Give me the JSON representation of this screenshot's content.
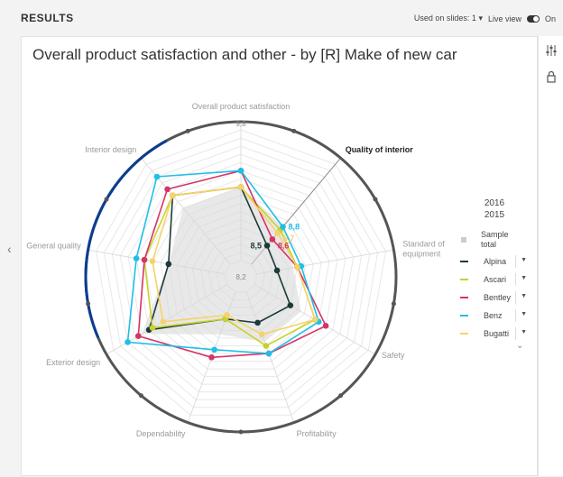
{
  "header": {
    "title": "RESULTS",
    "used_on": "Used on slides: 1",
    "live_view": "Live view",
    "toggle_state": "On"
  },
  "chart_title": "Overall product satisfaction and other - by [R] Make of new car",
  "chart_data": {
    "type": "radar",
    "title": "Overall product satisfaction and other - by [R] Make of new car",
    "axes": [
      "Overall product satisfaction",
      "Quality of interior",
      "Standard of equipment",
      "Safety",
      "Profitability",
      "Dependability",
      "Exterior design",
      "General quality",
      "Interior design"
    ],
    "range": [
      8.2,
      9.8
    ],
    "center_label": "8,2",
    "outer_label": "9,8",
    "highlighted_axis": "Quality of interior",
    "series": [
      {
        "name": "Sample total",
        "color": "#cccccc",
        "values": [
          9.1,
          8.8,
          8.65,
          8.85,
          8.85,
          8.75,
          9.4,
          8.9,
          9.1
        ]
      },
      {
        "name": "Alpina",
        "color": "#1c3a3a",
        "values": [
          9.1,
          8.5,
          8.45,
          8.7,
          8.6,
          8.55,
          9.3,
          8.9,
          9.3
        ]
      },
      {
        "name": "Ascari",
        "color": "#c8d22a",
        "values": [
          9.1,
          8.75,
          8.7,
          9.05,
          8.9,
          8.55,
          9.25,
          9.2,
          9.3
        ]
      },
      {
        "name": "Bentley",
        "color": "#d63366",
        "values": [
          9.3,
          8.6,
          8.7,
          9.2,
          9.0,
          9.05,
          9.45,
          9.2,
          9.4
        ]
      },
      {
        "name": "Benz",
        "color": "#1fbfe6",
        "values": [
          9.3,
          8.8,
          8.75,
          9.1,
          9.0,
          8.95,
          9.6,
          9.3,
          9.6
        ]
      },
      {
        "name": "Bugatti",
        "color": "#f5d36b",
        "values": [
          9.1,
          8.7,
          8.7,
          9.05,
          8.75,
          8.5,
          9.1,
          9.1,
          9.3
        ]
      }
    ],
    "data_labels": [
      {
        "axis": "Quality of interior",
        "series": "Benz",
        "text": "8,8"
      },
      {
        "axis": "Quality of interior",
        "series": "Bugatti",
        "text": "8,7"
      },
      {
        "axis": "Quality of interior",
        "series": "Bentley",
        "text": "8,6"
      },
      {
        "axis": "Quality of interior",
        "series": "Alpina",
        "text": "8,5"
      }
    ]
  },
  "legend": {
    "years": [
      "2016",
      "2015"
    ],
    "items": [
      {
        "label": "Sample total",
        "label_line1": "Sample",
        "label_line2": "total",
        "color": "#cccccc"
      },
      {
        "label": "Alpina",
        "color": "#1c3a3a"
      },
      {
        "label": "Ascari",
        "color": "#c8d22a"
      },
      {
        "label": "Bentley",
        "color": "#d63366"
      },
      {
        "label": "Benz",
        "color": "#1fbfe6"
      },
      {
        "label": "Bugatti",
        "color": "#f5d36b"
      }
    ]
  },
  "colors": {
    "ring_dark": "#555555",
    "ring_blue": "#0a3d91",
    "grid": "#e8e8e8"
  },
  "icons": [
    "settings-sliders-icon",
    "lock-icon",
    "chevron-left-icon",
    "chevron-down-icon",
    "caret-down-icon"
  ]
}
